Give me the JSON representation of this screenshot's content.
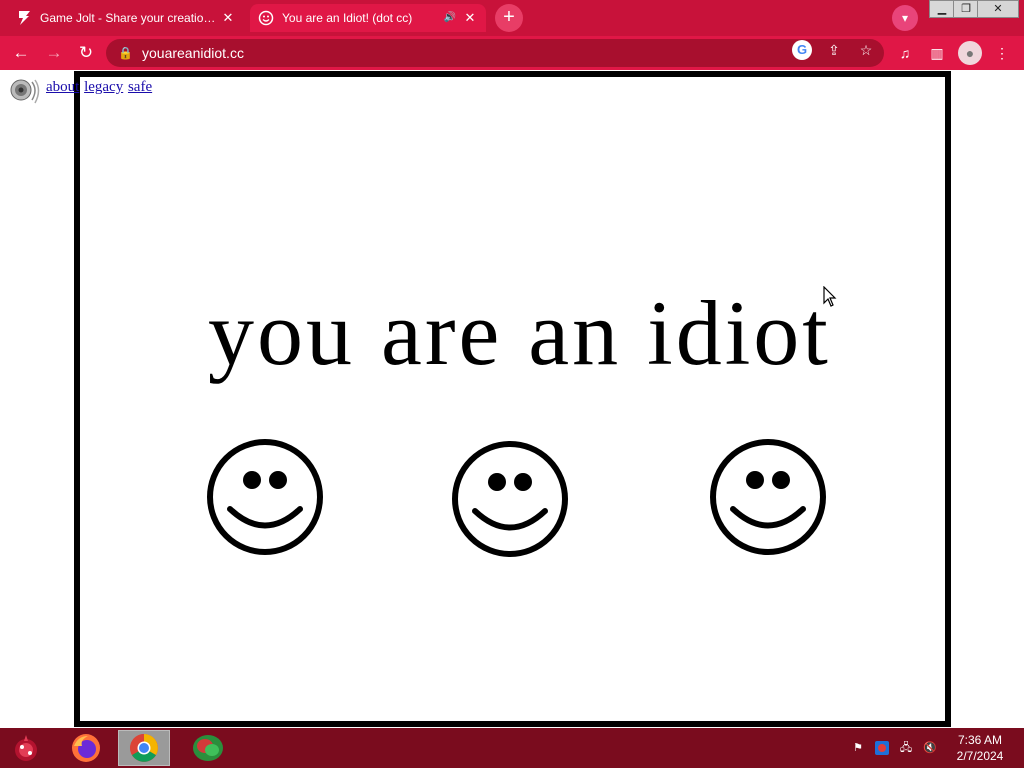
{
  "browser": {
    "tabs": [
      {
        "title": "Game Jolt - Share your creations",
        "active": false,
        "favicon": "game-jolt-icon"
      },
      {
        "title": "You are an Idiot! (dot cc)",
        "active": true,
        "favicon": "smiley-icon",
        "audio": true
      }
    ],
    "url": "youareanidiot.cc"
  },
  "page": {
    "links": [
      "about",
      "legacy",
      "safe"
    ],
    "headline": "you are an idiot"
  },
  "taskbar": {
    "time": "7:36 AM",
    "date": "2/7/2024"
  },
  "colors": {
    "browser_chrome": "#e01746",
    "tabstrip": "#c8123a",
    "taskbar": "#7a0c1e",
    "link": "#1a0dab"
  }
}
